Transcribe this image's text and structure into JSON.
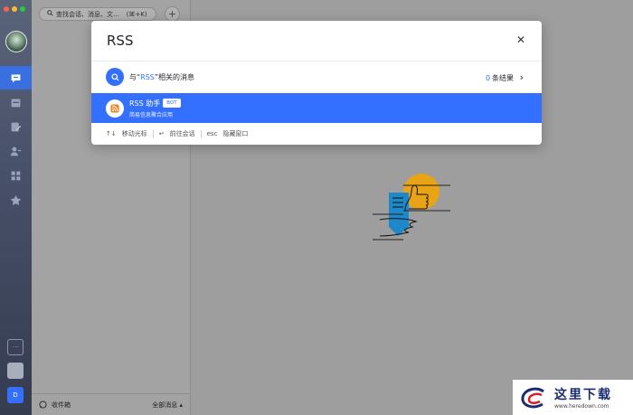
{
  "sidebar": {
    "traffic_lights": [
      "#ff5f57",
      "#febc2e",
      "#28c840"
    ],
    "nav_icons": [
      "chat-icon",
      "calendar-icon",
      "doc-edit-icon",
      "contacts-icon",
      "apps-grid-icon",
      "star-icon"
    ],
    "bottom_initial": "D"
  },
  "list_panel": {
    "search_placeholder": "查找会话、消息、文...",
    "search_shortcut": "(⌘+K)",
    "add_glyph": "+",
    "footer_inbox": "收件箱",
    "footer_filter": "全部消息 ▴"
  },
  "modal": {
    "query": "RSS",
    "close_glyph": "✕",
    "message_search": {
      "prefix": "与“",
      "keyword": "RSS",
      "suffix": "”相关的消息",
      "count": "0",
      "count_suffix": "条结果",
      "chevron": "›"
    },
    "result": {
      "name": "RSS 助手",
      "badge": "BOT",
      "desc": "简易信息聚合应用"
    },
    "footer": {
      "move_key": "↑↓",
      "move_label": "移动光标",
      "enter_key": "↵",
      "enter_label": "前往会话",
      "esc_key": "esc",
      "esc_label": "隐藏窗口"
    }
  },
  "watermark": {
    "cn": "这里下载",
    "url": "www.heredown.com"
  },
  "colors": {
    "accent": "#3370ff",
    "rss_orange": "#f5811f",
    "illus_yellow": "#e8a317",
    "illus_blue": "#1e88c8"
  }
}
